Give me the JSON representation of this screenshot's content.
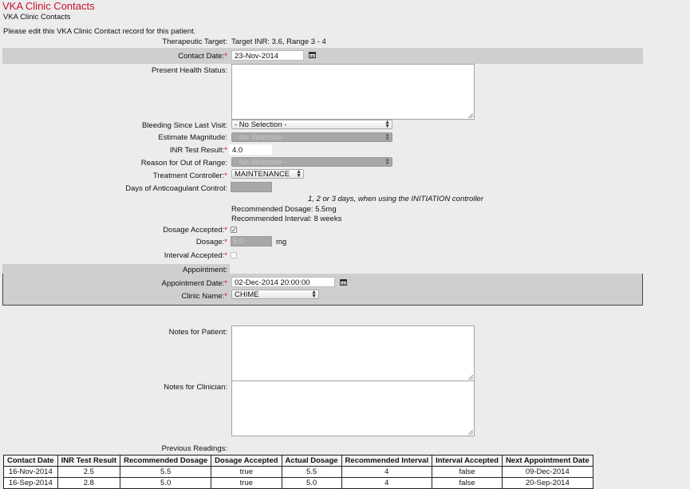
{
  "header": {
    "title": "VKA Clinic Contacts",
    "subtitle": "VKA Clinic Contacts",
    "intro": "Please edit this VKA Clinic Contact record for this patient."
  },
  "form": {
    "therapeutic_target": {
      "label": "Therapeutic Target:",
      "value": "Target INR: 3.6, Range 3 - 4"
    },
    "contact_date": {
      "label": "Contact Date:",
      "value": "23-Nov-2014"
    },
    "present_health_status": {
      "label": "Present Health Status:",
      "value": ""
    },
    "bleeding": {
      "label": "Bleeding Since Last Visit:",
      "value": "- No Selection -"
    },
    "estimate_magnitude": {
      "label": "Estimate Magnitude:",
      "value": "- No Selection -"
    },
    "inr_test_result": {
      "label": "INR Test Result:",
      "value": "4.0"
    },
    "reason_out_of_range": {
      "label": "Reason for Out of Range:",
      "value": "- No Selection -"
    },
    "treatment_controller": {
      "label": "Treatment Controller:",
      "value": "MAINTENANCE"
    },
    "days_anticoagulant": {
      "label": "Days of Anticoagulant Control:",
      "value": ""
    },
    "days_hint": "1, 2 or 3 days, when using the INITIATION controller",
    "recommended_dosage": "Recommended Dosage: 5.5mg",
    "recommended_interval": "Recommended Interval: 8 weeks",
    "dosage_accepted": {
      "label": "Dosage Accepted:",
      "checked": true,
      "mark": "✓"
    },
    "dosage": {
      "label": "Dosage:",
      "value": "5.0",
      "unit": "mg"
    },
    "interval_accepted": {
      "label": "Interval Accepted:",
      "checked": false
    },
    "appointment": {
      "label": "Appointment:"
    },
    "appointment_date": {
      "label": "Appointment Date:",
      "value": "02-Dec-2014 20:00:00"
    },
    "clinic_name": {
      "label": "Clinic Name:",
      "value": "CHIME"
    },
    "notes_patient": {
      "label": "Notes for Patient:",
      "value": ""
    },
    "notes_clinician": {
      "label": "Notes for Clinician:",
      "value": ""
    },
    "previous_readings_label": "Previous Readings:",
    "required_marker": "*"
  },
  "readings": {
    "columns": [
      "Contact Date",
      "INR Test Result",
      "Recommended Dosage",
      "Dosage Accepted",
      "Actual Dosage",
      "Recommended Interval",
      "Interval Accepted",
      "Next Appointment Date"
    ],
    "rows": [
      [
        "16-Nov-2014",
        "2.5",
        "5.5",
        "true",
        "5.5",
        "4",
        "false",
        "09-Dec-2014"
      ],
      [
        "16-Sep-2014",
        "2.8",
        "5.0",
        "true",
        "5.0",
        "4",
        "false",
        "20-Sep-2014"
      ]
    ]
  },
  "icons": {
    "calendar": "calendar-icon",
    "select_arrows": "updown-arrows-icon"
  },
  "colors": {
    "title": "#c8102e",
    "required": "#c8102e",
    "band": "#cfcfcf",
    "background": "#ececec"
  }
}
